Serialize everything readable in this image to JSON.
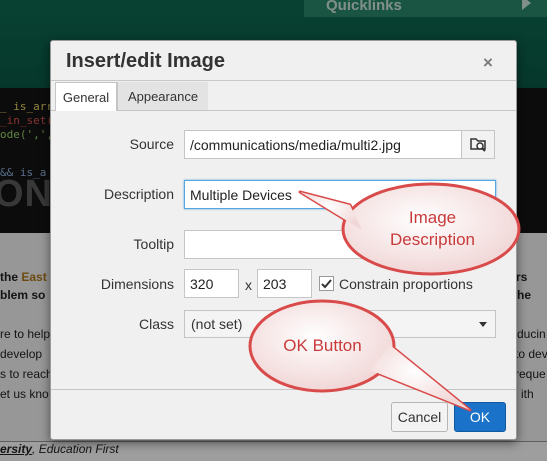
{
  "background": {
    "quicklinks": "Quicklinks",
    "code_lines": [
      "_ is_arra",
      "_in_set(",
      "ode(',',",
      "&& is_a"
    ],
    "hero_word": "ONS",
    "text_lines": [
      {
        "left": "the",
        "right": "ners"
      },
      {
        "left": "blem so",
        "right": "he"
      },
      {
        "left": "re to help",
        "right": "ducin"
      },
      {
        "left": "develop",
        "right": "to dev"
      },
      {
        "left": "s to reach",
        "right": "reque"
      },
      {
        "left": "et us kno",
        "right": "ith"
      }
    ],
    "text_highlight": "East",
    "footer_left": "ersity",
    "footer_right": ", Education First"
  },
  "dialog": {
    "title": "Insert/edit Image",
    "close_symbol": "×",
    "tabs": [
      {
        "label": "General",
        "active": true
      },
      {
        "label": "Appearance",
        "active": false
      }
    ],
    "fields": {
      "source_label": "Source",
      "source_value": "/communications/media/multi2.jpg",
      "description_label": "Description",
      "description_value": "Multiple Devices",
      "tooltip_label": "Tooltip",
      "tooltip_value": "",
      "dimensions_label": "Dimensions",
      "width_value": "320",
      "times_symbol": "x",
      "height_value": "203",
      "constrain_label": "Constrain proportions",
      "constrain_checked": true,
      "class_label": "Class",
      "class_value": "(not set)"
    },
    "buttons": {
      "cancel": "Cancel",
      "ok": "OK"
    }
  },
  "annotations": {
    "image_description": "Image Description",
    "ok_button": "OK Button"
  },
  "colors": {
    "accent_blue": "#1a72c9",
    "annotation_red": "#d94a4a",
    "header_green": "#0d6a52"
  }
}
